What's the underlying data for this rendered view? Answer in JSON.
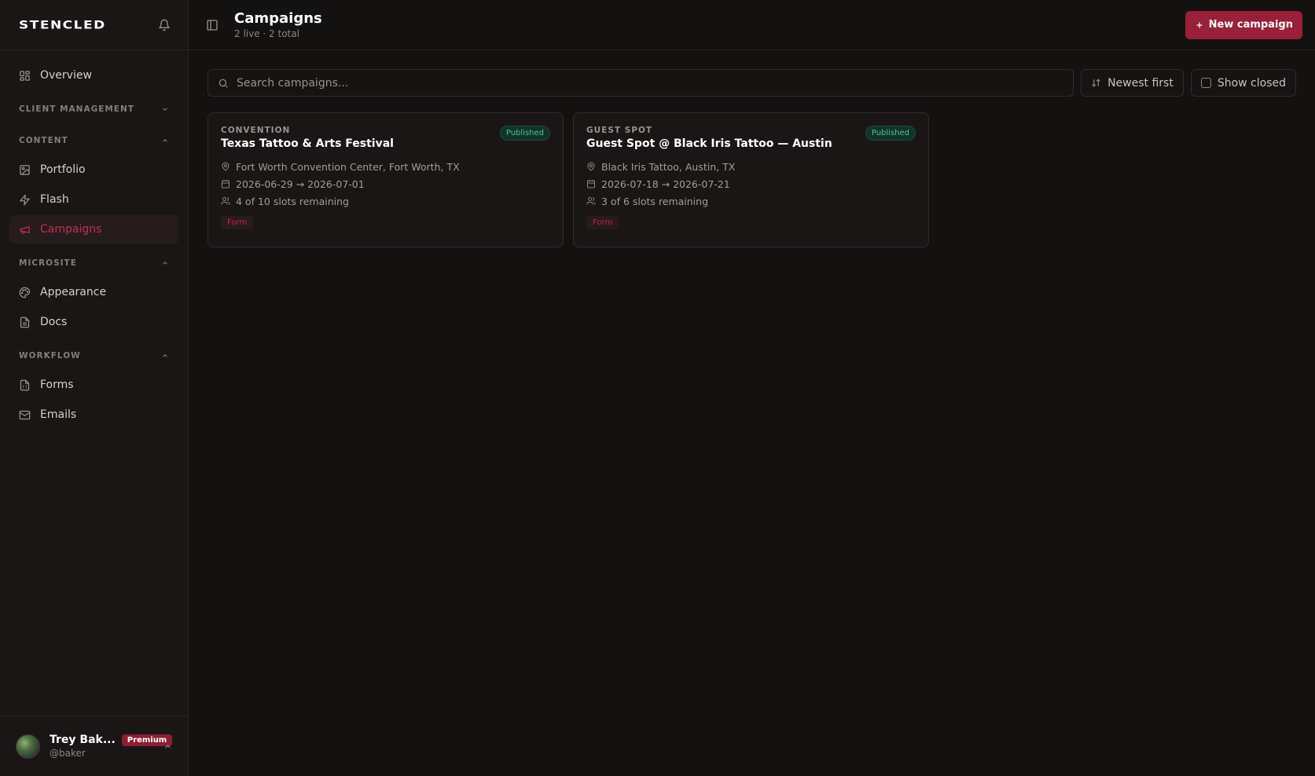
{
  "brand": {
    "logo": "STENCLED"
  },
  "sidebar": {
    "top_items": [
      {
        "label": "Overview",
        "icon": "grid-icon"
      }
    ],
    "sections": [
      {
        "title": "CLIENT MANAGEMENT",
        "collapsed": true,
        "items": []
      },
      {
        "title": "CONTENT",
        "collapsed": false,
        "items": [
          {
            "label": "Portfolio",
            "icon": "image-icon"
          },
          {
            "label": "Flash",
            "icon": "lightning-icon"
          },
          {
            "label": "Campaigns",
            "icon": "megaphone-icon",
            "active": true
          }
        ]
      },
      {
        "title": "MICROSITE",
        "collapsed": false,
        "items": [
          {
            "label": "Appearance",
            "icon": "palette-icon"
          },
          {
            "label": "Docs",
            "icon": "document-icon"
          }
        ]
      },
      {
        "title": "WORKFLOW",
        "collapsed": false,
        "items": [
          {
            "label": "Forms",
            "icon": "form-icon"
          },
          {
            "label": "Emails",
            "icon": "mail-icon"
          }
        ]
      }
    ],
    "user": {
      "name": "Trey Bak...",
      "handle": "@baker",
      "badge": "Premium"
    }
  },
  "header": {
    "title": "Campaigns",
    "subtitle": "2 live · 2 total",
    "new_button": "New campaign"
  },
  "toolbar": {
    "search_placeholder": "Search campaigns...",
    "sort_label": "Newest first",
    "show_closed_label": "Show closed"
  },
  "campaigns": [
    {
      "type": "CONVENTION",
      "title": "Texas Tattoo & Arts Festival",
      "status": "Published",
      "location": "Fort Worth Convention Center, Fort Worth, TX",
      "dates": "2026-06-29 → 2026-07-01",
      "slots": "4 of 10 slots remaining",
      "tag": "Form"
    },
    {
      "type": "GUEST SPOT",
      "title": "Guest Spot @ Black Iris Tattoo — Austin",
      "status": "Published",
      "location": "Black Iris Tattoo, Austin, TX",
      "dates": "2026-07-18 → 2026-07-21",
      "slots": "3 of 6 slots remaining",
      "tag": "Form"
    }
  ],
  "colors": {
    "accent": "#9a1f38",
    "active_text": "#c0314a",
    "published_bg": "#12332a",
    "published_text": "#4ec28c"
  }
}
